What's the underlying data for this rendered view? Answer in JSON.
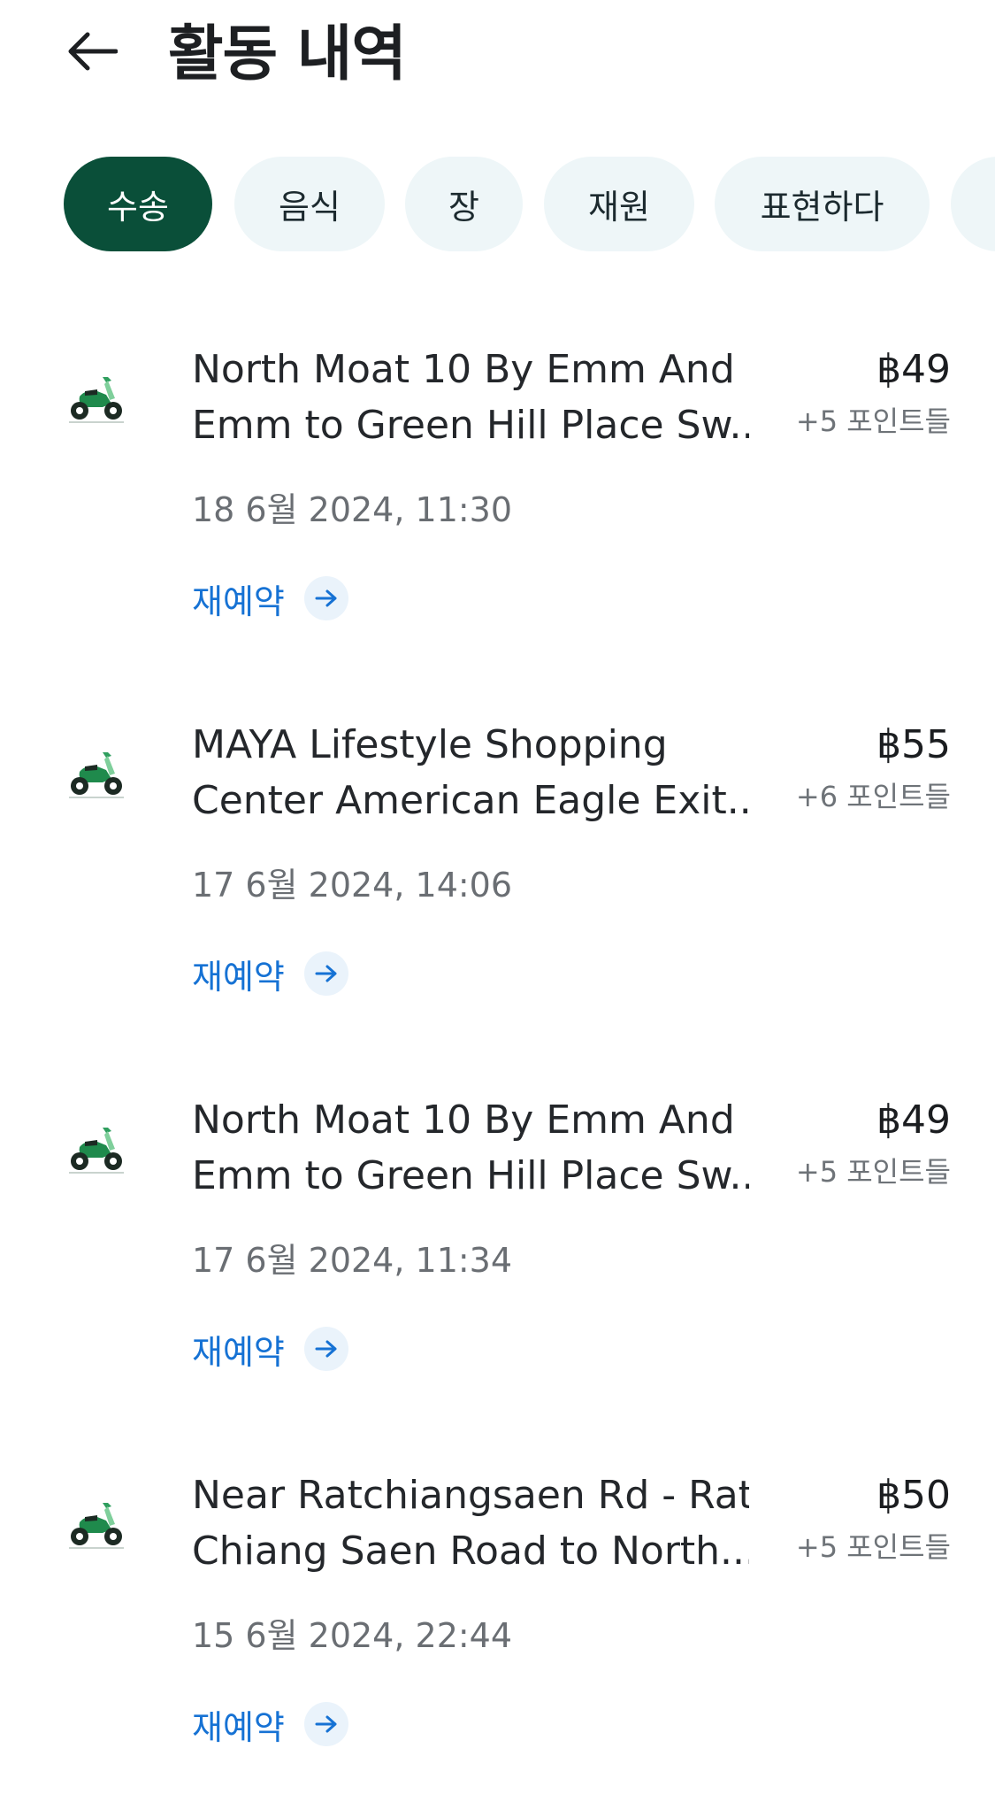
{
  "header": {
    "title": "활동 내역",
    "back_icon": "arrow-left-icon"
  },
  "filters": {
    "chips": [
      {
        "label": "수송",
        "active": true
      },
      {
        "label": "음식",
        "active": false
      },
      {
        "label": "장",
        "active": false
      },
      {
        "label": "재원",
        "active": false
      },
      {
        "label": "표현하다",
        "active": false
      }
    ]
  },
  "activities": [
    {
      "icon": "motorbike-icon",
      "route_line1": "North Moat 10 By Emm And",
      "route_line2": "Emm to Green Hill Place Sw...",
      "price": "฿49",
      "points": "+5 포인트들",
      "date": "18 6월 2024, 11:30",
      "rebook_label": "재예약"
    },
    {
      "icon": "motorbike-icon",
      "route_line1": "MAYA Lifestyle Shopping",
      "route_line2": "Center American Eagle Exit...",
      "price": "฿55",
      "points": "+6 포인트들",
      "date": "17 6월 2024, 14:06",
      "rebook_label": "재예약"
    },
    {
      "icon": "motorbike-icon",
      "route_line1": "North Moat 10 By Emm And",
      "route_line2": "Emm to Green Hill Place Sw...",
      "price": "฿49",
      "points": "+5 포인트들",
      "date": "17 6월 2024, 11:34",
      "rebook_label": "재예약"
    },
    {
      "icon": "motorbike-icon",
      "route_line1": "Near Ratchiangsaen Rd - Rat",
      "route_line2": "Chiang Saen Road to North...",
      "price": "฿50",
      "points": "+5 포인트들",
      "date": "15 6월 2024, 22:44",
      "rebook_label": "재예약"
    }
  ],
  "colors": {
    "active_chip": "#0a4f39",
    "inactive_chip": "#eef6f8",
    "link": "#1672d4",
    "bike_green": "#1f8a4c"
  }
}
